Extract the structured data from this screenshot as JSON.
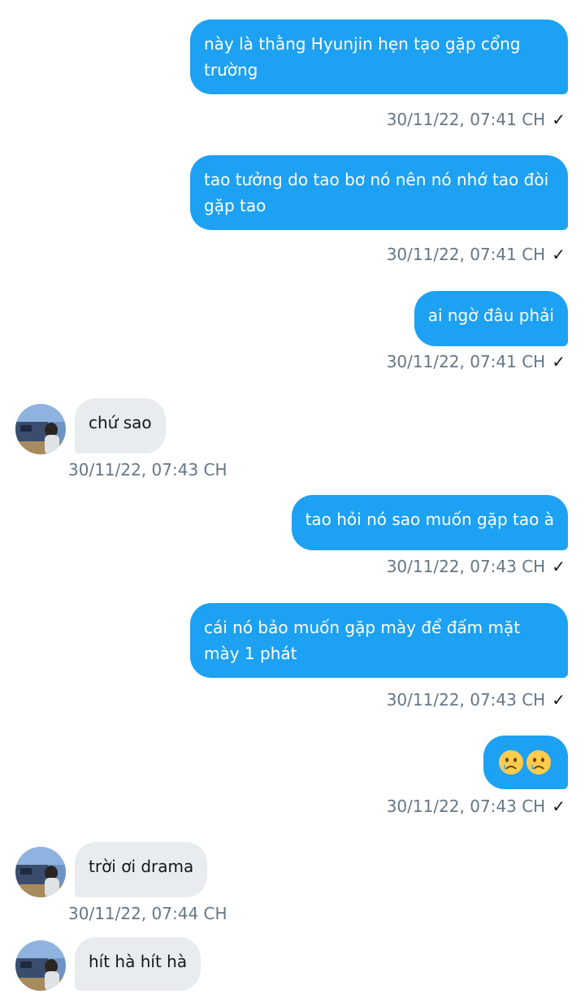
{
  "conversation": {
    "messages": [
      {
        "side": "out",
        "text": "này là thằng Hyunjin hẹn tạo gặp cổng trường",
        "time": "30/11/22,  07:41 CH",
        "read": true
      },
      {
        "side": "out",
        "text": "tao tưởng do tao bơ nó nên nó nhớ tao đòi gặp tao",
        "time": "30/11/22,  07:41 CH",
        "read": true
      },
      {
        "side": "out",
        "text": "ai ngờ đâu phải",
        "time": "30/11/22,  07:41 CH",
        "read": true
      },
      {
        "side": "in",
        "text": "chứ sao",
        "time": "30/11/22,  07:43 CH"
      },
      {
        "side": "out",
        "text": "tao hỏi nó sao muốn gặp tao à",
        "time": "30/11/22,  07:43 CH",
        "read": true
      },
      {
        "side": "out",
        "text": "cái nó bảo muốn gặp mày để đấm mặt mày 1 phát",
        "time": "30/11/22,  07:43 CH",
        "read": true
      },
      {
        "side": "out",
        "emoji": [
          "crying-face",
          "crying-face"
        ],
        "time": "30/11/22,  07:43 CH",
        "read": true
      },
      {
        "side": "in",
        "text": "trời ơi drama",
        "time": "30/11/22,  07:44 CH"
      },
      {
        "side": "in",
        "text": "hít hà hít hà",
        "time": ""
      }
    ],
    "read_mark": "✓",
    "colors": {
      "outgoing_bubble": "#1da1f2",
      "incoming_bubble": "#e8ecef",
      "timestamp": "#657786"
    }
  }
}
